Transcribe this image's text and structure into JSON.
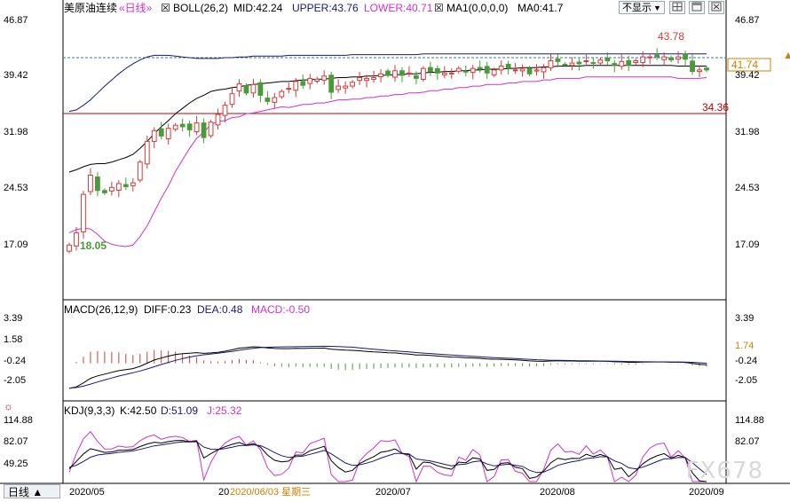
{
  "header": {
    "instrument": "美原油连续",
    "period_tag": "«日线»",
    "boll_check": "☒",
    "boll_text": "BOLL(26,2)",
    "mid_text": "MID:42.24",
    "upper_text": "UPPER:43.76",
    "lower_text": "LOWER:40.71",
    "ma_check": "☒",
    "ma_text": "MA1(0,0,0,0)",
    "ma0_text": "MA0:41.7",
    "hide_label": "不显示",
    "hide_arrow": "▼"
  },
  "colors": {
    "up": "#d63a3a",
    "down": "#4a9a3a",
    "mid": "#000000",
    "upper": "#1a1a6e",
    "lower": "#cc33cc",
    "macd_dea": "#1a1a6e",
    "kdj_k": "#000000",
    "kdj_d": "#1a1a6e",
    "kdj_j": "#cc33cc",
    "hline": "#c00000",
    "axis": "#000000"
  },
  "price_panel": {
    "y_ticks": [
      "46.87",
      "39.42",
      "31.98",
      "24.53",
      "17.09"
    ],
    "high_label": "43.78",
    "low_label": "18.05",
    "hline_label": "34.36",
    "current_label": "41.74"
  },
  "macd_panel": {
    "title": "MACD(26,12,9)",
    "diff_text": "DIFF:0.23",
    "dea_text": "DEA:0.48",
    "macd_text": "MACD:-0.50",
    "y_ticks": [
      "3.39",
      "1.58",
      "-0.24",
      "-2.05"
    ],
    "right_marker": "1.74"
  },
  "kdj_panel": {
    "title": "KDJ(9,3,3)",
    "k_text": "K:42.50",
    "d_text": "D:51.09",
    "j_text": "J:25.32",
    "y_ticks": [
      "114.88",
      "82.07",
      "49.25"
    ]
  },
  "x_axis": {
    "labels": [
      "2020/05",
      "2020/07",
      "2020/08",
      "2020/09"
    ],
    "cursor_prefix": "20",
    "cursor_label": "2020/06/03 星期三"
  },
  "footer": {
    "day_button": "日线 ▲",
    "watermark": "FX678"
  },
  "chart_data": {
    "type": "candlestick",
    "title": "美原油连续",
    "period": "日线",
    "indicators": {
      "BOLL": {
        "params": "26,2",
        "mid": 42.24,
        "upper": 43.76,
        "lower": 40.71
      },
      "MA0": 41.7,
      "MACD": {
        "params": "26,12,9",
        "diff": 0.23,
        "dea": 0.48,
        "macd": -0.5
      },
      "KDJ": {
        "params": "9,3,3",
        "k": 42.5,
        "d": 51.09,
        "j": 25.32
      }
    },
    "price_range": [
      12.0,
      48.5
    ],
    "annotations": {
      "high": 43.78,
      "low": 18.05,
      "hline": 34.36,
      "last": 41.74
    },
    "closes": [
      18.9,
      20.5,
      25.5,
      28.0,
      26.0,
      25.7,
      26.4,
      26.9,
      26.5,
      27.0,
      29.7,
      32.4,
      33.8,
      33.1,
      34.1,
      34.5,
      34.3,
      33.9,
      34.8,
      32.9,
      34.9,
      35.9,
      37.1,
      38.6,
      39.9,
      38.7,
      39.8,
      38.4,
      37.6,
      38.1,
      38.9,
      39.3,
      40.2,
      39.7,
      40.6,
      40.5,
      40.9,
      38.8,
      39.6,
      39.6,
      40.1,
      40.7,
      40.6,
      40.7,
      41.2,
      41.0,
      41.6,
      41.0,
      41.3,
      40.6,
      41.9,
      41.5,
      41.3,
      41.3,
      41.3,
      41.9,
      41.5,
      41.9,
      41.8,
      41.3,
      41.7,
      42.2,
      42.0,
      41.7,
      41.8,
      41.2,
      41.7,
      42.0,
      42.9,
      42.8,
      42.4,
      42.6,
      42.5,
      42.9,
      42.6,
      43.0,
      42.9,
      42.3,
      42.8,
      42.3,
      42.9,
      43.4,
      43.4,
      43.4,
      43.4,
      43.0,
      43.4,
      43.1,
      41.5,
      41.7,
      41.7
    ],
    "mid": [
      28.4,
      28.7,
      29.1,
      29.4,
      29.5,
      29.5,
      29.7,
      30.0,
      30.3,
      30.7,
      31.5,
      32.4,
      33.4,
      34.3,
      35.1,
      36.0,
      36.7,
      37.4,
      38.0,
      38.4,
      38.9,
      39.1,
      39.2,
      39.4,
      39.5,
      39.7,
      39.8,
      39.9,
      40.0,
      40.1,
      40.2,
      40.2,
      40.3,
      40.4,
      40.4,
      40.5,
      40.5,
      40.6,
      40.7,
      40.7,
      40.8,
      40.8,
      40.9,
      40.9,
      41.0,
      41.0,
      41.1,
      41.1,
      41.2,
      41.2,
      41.3,
      41.4,
      41.4,
      41.5,
      41.5,
      41.6,
      41.6,
      41.7,
      41.7,
      41.8,
      41.8,
      41.8,
      41.9,
      41.9,
      42.0,
      42.0,
      42.0,
      42.1,
      42.1,
      42.2,
      42.2,
      42.2,
      42.2,
      42.3,
      42.3,
      42.3,
      42.3,
      42.3,
      42.3,
      42.3,
      42.3,
      42.3,
      42.3,
      42.3,
      42.3,
      42.3,
      42.2,
      42.2,
      42.2,
      42.2,
      42.2
    ],
    "upper": [
      36.3,
      36.5,
      37.1,
      37.8,
      38.7,
      39.6,
      40.4,
      41.2,
      41.9,
      42.5,
      43.0,
      43.4,
      43.6,
      43.6,
      43.6,
      43.5,
      43.4,
      43.3,
      43.2,
      43.2,
      43.2,
      43.2,
      43.3,
      43.3,
      43.4,
      43.4,
      43.5,
      43.5,
      43.5,
      43.5,
      43.5,
      43.6,
      43.6,
      43.6,
      43.6,
      43.6,
      43.6,
      43.6,
      43.6,
      43.6,
      43.7,
      43.7,
      43.7,
      43.7,
      43.7,
      43.7,
      43.7,
      43.7,
      43.7,
      43.7,
      43.8,
      43.8,
      43.8,
      43.8,
      43.8,
      43.8,
      43.8,
      43.8,
      43.8,
      43.8,
      43.8,
      43.8,
      43.8,
      43.8,
      43.8,
      43.8,
      43.8,
      43.8,
      43.8,
      43.8,
      43.8,
      43.8,
      43.8,
      43.8,
      43.8,
      43.8,
      43.8,
      43.8,
      43.8,
      43.8,
      43.8,
      43.8,
      43.8,
      43.8,
      43.8,
      43.8,
      43.8,
      43.8,
      43.8,
      43.8,
      43.8
    ],
    "lower": [
      20.5,
      20.9,
      21.1,
      21.0,
      20.3,
      19.4,
      19.0,
      18.8,
      18.7,
      18.9,
      20.0,
      21.4,
      23.2,
      25.0,
      26.6,
      28.5,
      30.0,
      31.5,
      32.8,
      33.6,
      34.6,
      35.0,
      35.1,
      35.5,
      35.6,
      36.0,
      36.1,
      36.3,
      36.5,
      36.7,
      36.9,
      36.8,
      37.0,
      37.2,
      37.2,
      37.4,
      37.4,
      37.6,
      37.8,
      37.8,
      37.9,
      37.9,
      38.1,
      38.1,
      38.3,
      38.3,
      38.5,
      38.5,
      38.7,
      38.7,
      38.8,
      39.0,
      39.0,
      39.2,
      39.2,
      39.4,
      39.4,
      39.6,
      39.6,
      39.8,
      39.8,
      39.8,
      40.0,
      40.0,
      40.2,
      40.2,
      40.2,
      40.4,
      40.4,
      40.6,
      40.6,
      40.6,
      40.6,
      40.8,
      40.8,
      40.8,
      40.8,
      40.8,
      40.8,
      40.8,
      40.8,
      40.8,
      40.8,
      40.8,
      40.8,
      40.8,
      40.6,
      40.6,
      40.6,
      40.6,
      40.7
    ],
    "macd_range": [
      -3.0,
      4.2
    ],
    "kdj_range": [
      40,
      125
    ]
  }
}
